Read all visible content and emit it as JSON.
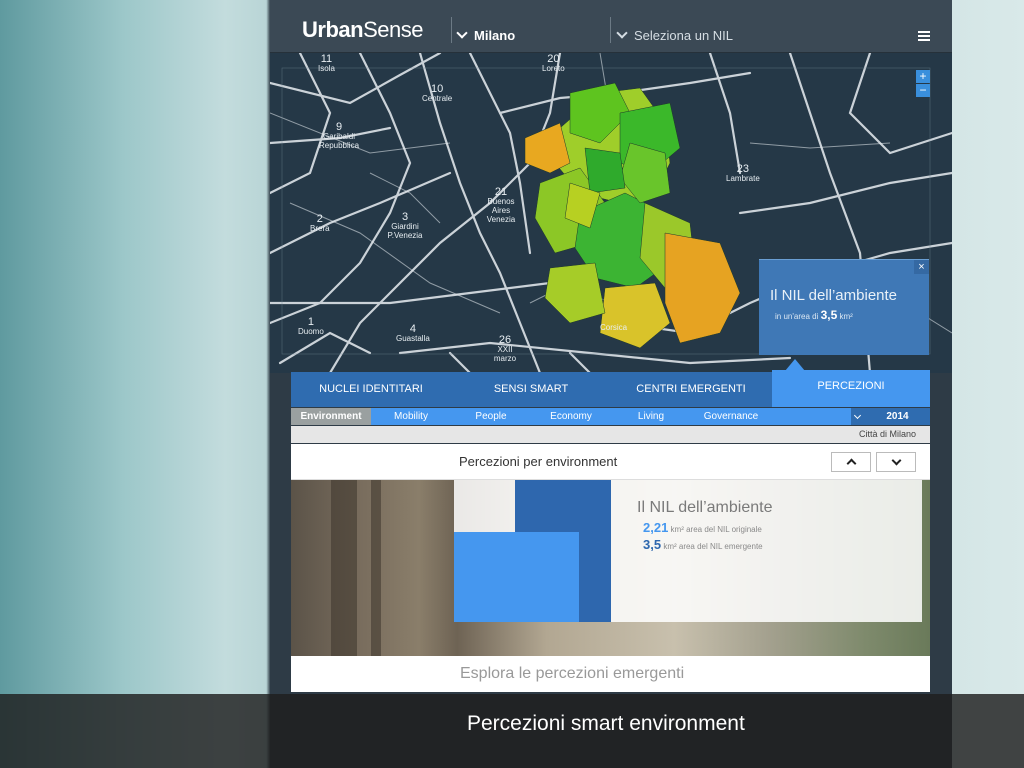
{
  "header": {
    "brand_bold": "Urban",
    "brand_light": "Sense",
    "city": "Milano",
    "nil_select": "Seleziona un NIL"
  },
  "map": {
    "zoom_in": "+",
    "zoom_out": "−",
    "labels": [
      {
        "num": "11",
        "name": "Isola"
      },
      {
        "num": "10",
        "name": "Centrale"
      },
      {
        "num": "20",
        "name": "Loreto"
      },
      {
        "num": "9",
        "name": "Garibaldi Repubblica"
      },
      {
        "num": "21",
        "name": "Buenos Aires Venezia"
      },
      {
        "num": "23",
        "name": "Lambrate"
      },
      {
        "num": "2",
        "name": "Brera"
      },
      {
        "num": "3",
        "name": "Giardini P.Venezia"
      },
      {
        "num": "1",
        "name": "Duomo"
      },
      {
        "num": "4",
        "name": "Guastalla"
      },
      {
        "num": "26",
        "name": "XXII marzo"
      },
      {
        "num": "",
        "name": "Corsica"
      }
    ],
    "popup": {
      "title": "Il NIL dell’ambiente",
      "sub_prefix": "in un'area di",
      "sub_value": "3,5",
      "sub_unit": "km²",
      "close": "×"
    }
  },
  "tabs": [
    "NUCLEI IDENTITARI",
    "SENSI SMART",
    "CENTRI EMERGENTI",
    "PERCEZIONI"
  ],
  "subtabs": [
    "Environment",
    "Mobility",
    "People",
    "Economy",
    "Living",
    "Governance"
  ],
  "year": "2014",
  "city_label": "Città di Milano",
  "perc_title": "Percezioni per environment",
  "chart": {
    "title": "Il NIL dell’ambiente",
    "row1_value": "2,21",
    "row1_text": "km² area del NIL originale",
    "row2_value": "3,5",
    "row2_text": "km² area del NIL emergente"
  },
  "explore": "Esplora le percezioni emergenti",
  "caption": "Percezioni smart environment",
  "colors": {
    "accent": "#4597ef",
    "accent_dark": "#2e67ae",
    "topbar": "#3b4955"
  }
}
